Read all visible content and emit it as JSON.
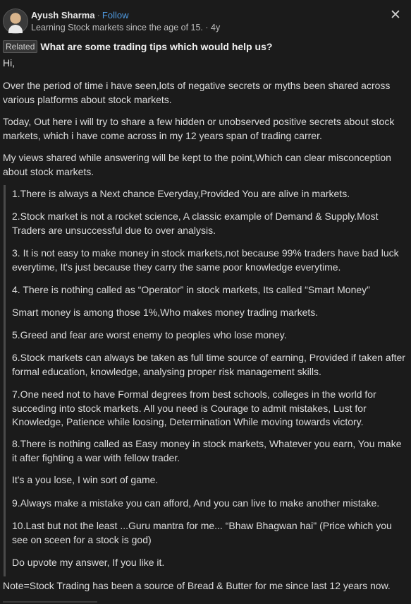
{
  "header": {
    "author": "Ayush Sharma",
    "separator": "·",
    "follow": "Follow",
    "bio": "Learning Stock markets since the age of 15. · 4y",
    "close_glyph": "✕"
  },
  "related": {
    "badge": "Related",
    "question": "What are some trading tips which would help us?"
  },
  "intro": [
    "Hi,",
    "Over the period of time i have seen,lots of negative secrets or myths been shared across various platforms about stock markets.",
    "Today, Out here i will try to share a few hidden or unobserved positive secrets about stock markets, which i have come across in my 12 years span of trading carrer.",
    "My views shared while answering will be kept to the point,Which can clear misconception about stock markets."
  ],
  "quote": [
    "1.There is always a Next chance Everyday,Provided You are alive in markets.",
    "2.Stock market is not a rocket science, A classic example of Demand & Supply.Most Traders are unsuccessful due to over analysis.",
    "3. It is not easy to make money in stock markets,not because 99% traders have bad luck everytime, It's just because they carry the same poor knowledge everytime.",
    "4. There is nothing called as “Operator” in stock markets, Its called “Smart Money”",
    "Smart money is among those 1%,Who makes money trading markets.",
    "5.Greed and fear are worst enemy to peoples who lose money.",
    "6.Stock markets can always be taken as full time source of earning, Provided if taken after formal education, knowledge, analysing proper risk management skills.",
    "7.One need not to have Formal degrees from best schools, colleges in the world for succeding into stock markets. All you need is Courage to admit mistakes, Lust for Knowledge, Patience while loosing, Determination While moving towards victory.",
    "8.There is nothing called as Easy money in stock markets, Whatever you earn, You make it after fighting a war with fellow trader.",
    "It's a you lose, I win sort of game.",
    "9.Always make a mistake you can afford, And you can live to make another mistake.",
    "10.Last but not the least ...Guru mantra for me... “Bhaw Bhagwan hai\" (Price which you see on sceen for a stock is god)",
    "Do upvote my answer, If you like it."
  ],
  "note": "Note=Stock Trading has been a source of Bread & Butter for me since last 12 years now."
}
